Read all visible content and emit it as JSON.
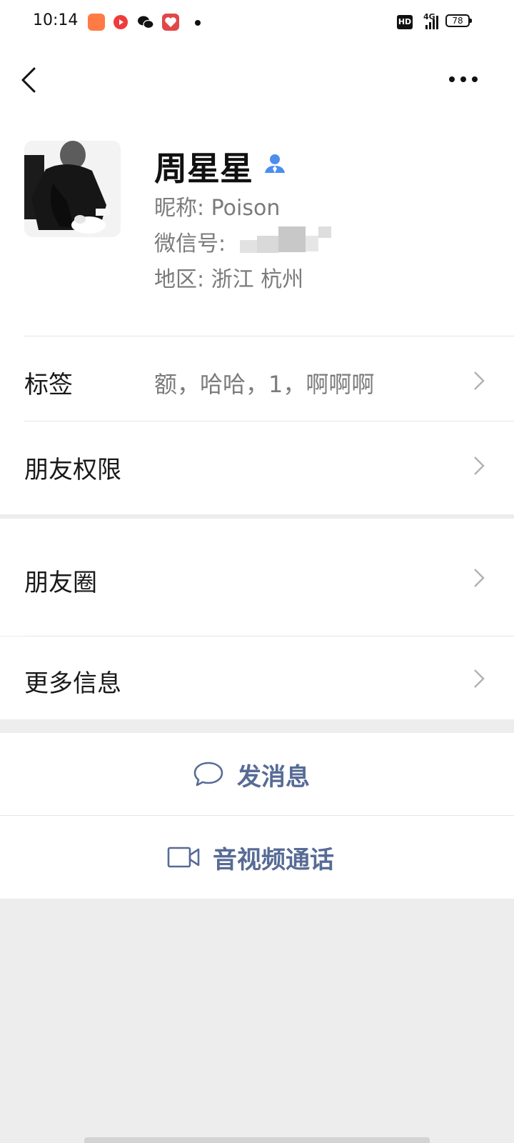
{
  "status_bar": {
    "time": "10:14",
    "network": "4G",
    "hd": "HD",
    "battery": "78",
    "apps": [
      {
        "icon": "kuaishou-app-icon",
        "color": "#ff6a3d"
      },
      {
        "icon": "video-app-icon",
        "color": "#ff3b30"
      },
      {
        "icon": "wechat-app-icon",
        "color": "#111111"
      },
      {
        "icon": "gift-app-icon",
        "color": "#e24a4a"
      }
    ]
  },
  "header": {
    "back_icon": "chevron-left-icon",
    "more_icon": "more-dots-icon"
  },
  "profile": {
    "name": "周星星",
    "nickname_line": "昵称:  Poison",
    "wechat_id_label": "微信号:",
    "region_line": "地区:  浙江  杭州",
    "contact_icon": "contact-person-icon",
    "accent_color": "#4b8ef0"
  },
  "rows": {
    "tags": {
      "label": "标签",
      "value": "额，哈哈，1，啊啊啊"
    },
    "friend_permissions": {
      "label": "朋友权限"
    },
    "moments": {
      "label": "朋友圈"
    },
    "more_info": {
      "label": "更多信息"
    }
  },
  "actions": {
    "send_message": {
      "label": "发消息",
      "icon": "chat-bubble-icon"
    },
    "av_call": {
      "label": "音视频通话",
      "icon": "video-camera-icon"
    }
  },
  "colors": {
    "action_text": "#576b95",
    "background": "#ededed"
  }
}
